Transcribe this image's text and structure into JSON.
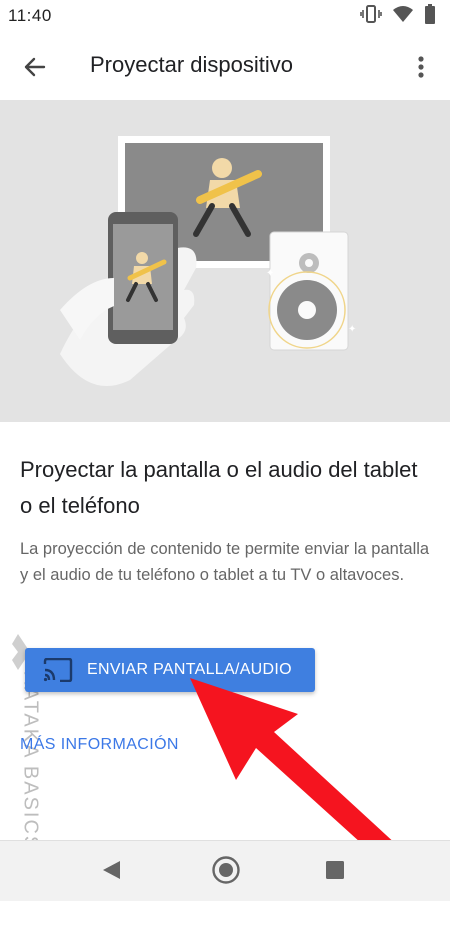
{
  "status": {
    "time": "11:40"
  },
  "appbar": {
    "title": "Proyectar dispositivo"
  },
  "content": {
    "heading": "Proyectar la pantalla o el audio del tablet o el teléfono",
    "description": "La proyección de contenido te permite enviar la pantalla y el audio de tu teléfono o tablet a tu TV o altavoces.",
    "cast_button_label": "ENVIAR PANTALLA/AUDIO",
    "more_info_link": "MÁS INFORMACIÓN"
  },
  "watermark": {
    "text": "XATAKA BASICS"
  },
  "icons": {
    "back": "arrow-left-icon",
    "overflow": "more-vert-icon",
    "cast": "cast-icon",
    "vibrate": "vibrate-icon",
    "wifi": "wifi-icon",
    "battery": "battery-icon"
  },
  "colors": {
    "accent": "#3f7fe0",
    "link": "#3b78e7",
    "annotation_arrow": "#f5141f",
    "hero_bg": "#e3e3e3"
  }
}
